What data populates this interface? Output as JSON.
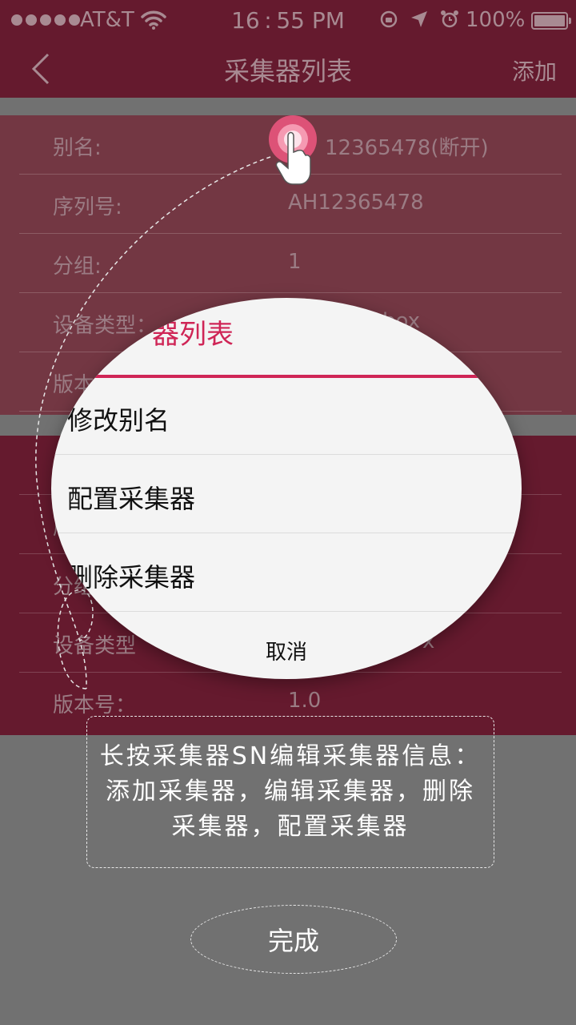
{
  "status_bar": {
    "carrier": "AT&T",
    "time": "16 : 55 PM",
    "battery_pct": "100%"
  },
  "nav": {
    "title": "采集器列表",
    "add_label": "添加"
  },
  "card1": {
    "rows": [
      {
        "label": "别名:",
        "value": "12365478(断开)"
      },
      {
        "label": "序列号:",
        "value": "AH12365478"
      },
      {
        "label": "分组:",
        "value": "1"
      },
      {
        "label": "设备类型：",
        "value": "box"
      },
      {
        "label": "版本",
        "value": ""
      }
    ]
  },
  "card2": {
    "rows": [
      {
        "label": "",
        "value": ""
      },
      {
        "label": "序",
        "value": ""
      },
      {
        "label": "分组",
        "value": ""
      },
      {
        "label": "设备类型",
        "value": "x"
      },
      {
        "label": "版本号：",
        "value": "1.0"
      }
    ]
  },
  "popup": {
    "title": "器列表",
    "items": [
      "修改别名",
      "配置采集器",
      "删除采集器"
    ],
    "cancel": "取消"
  },
  "tip": {
    "text": "长按采集器SN编辑采集器信息：添加采集器，编辑采集器，删除采集器，配置采集器"
  },
  "done_label": "完成",
  "colors": {
    "header": "#651a2e",
    "card_highlight": "#733743",
    "accent": "#cf2556",
    "overlay": "#717171"
  }
}
